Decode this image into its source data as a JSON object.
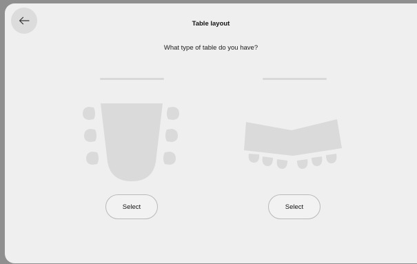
{
  "header": {
    "title": "Table layout",
    "back_icon": "arrow-left-icon"
  },
  "prompt": "What type of table do you have?",
  "options": [
    {
      "id": "u-shape",
      "illustration": "u-shaped-table-icon",
      "button_label": "Select"
    },
    {
      "id": "wide-angled",
      "illustration": "angled-table-icon",
      "button_label": "Select"
    }
  ],
  "colors": {
    "background": "#efefef",
    "illustration": "#dadada",
    "text": "#111111"
  }
}
